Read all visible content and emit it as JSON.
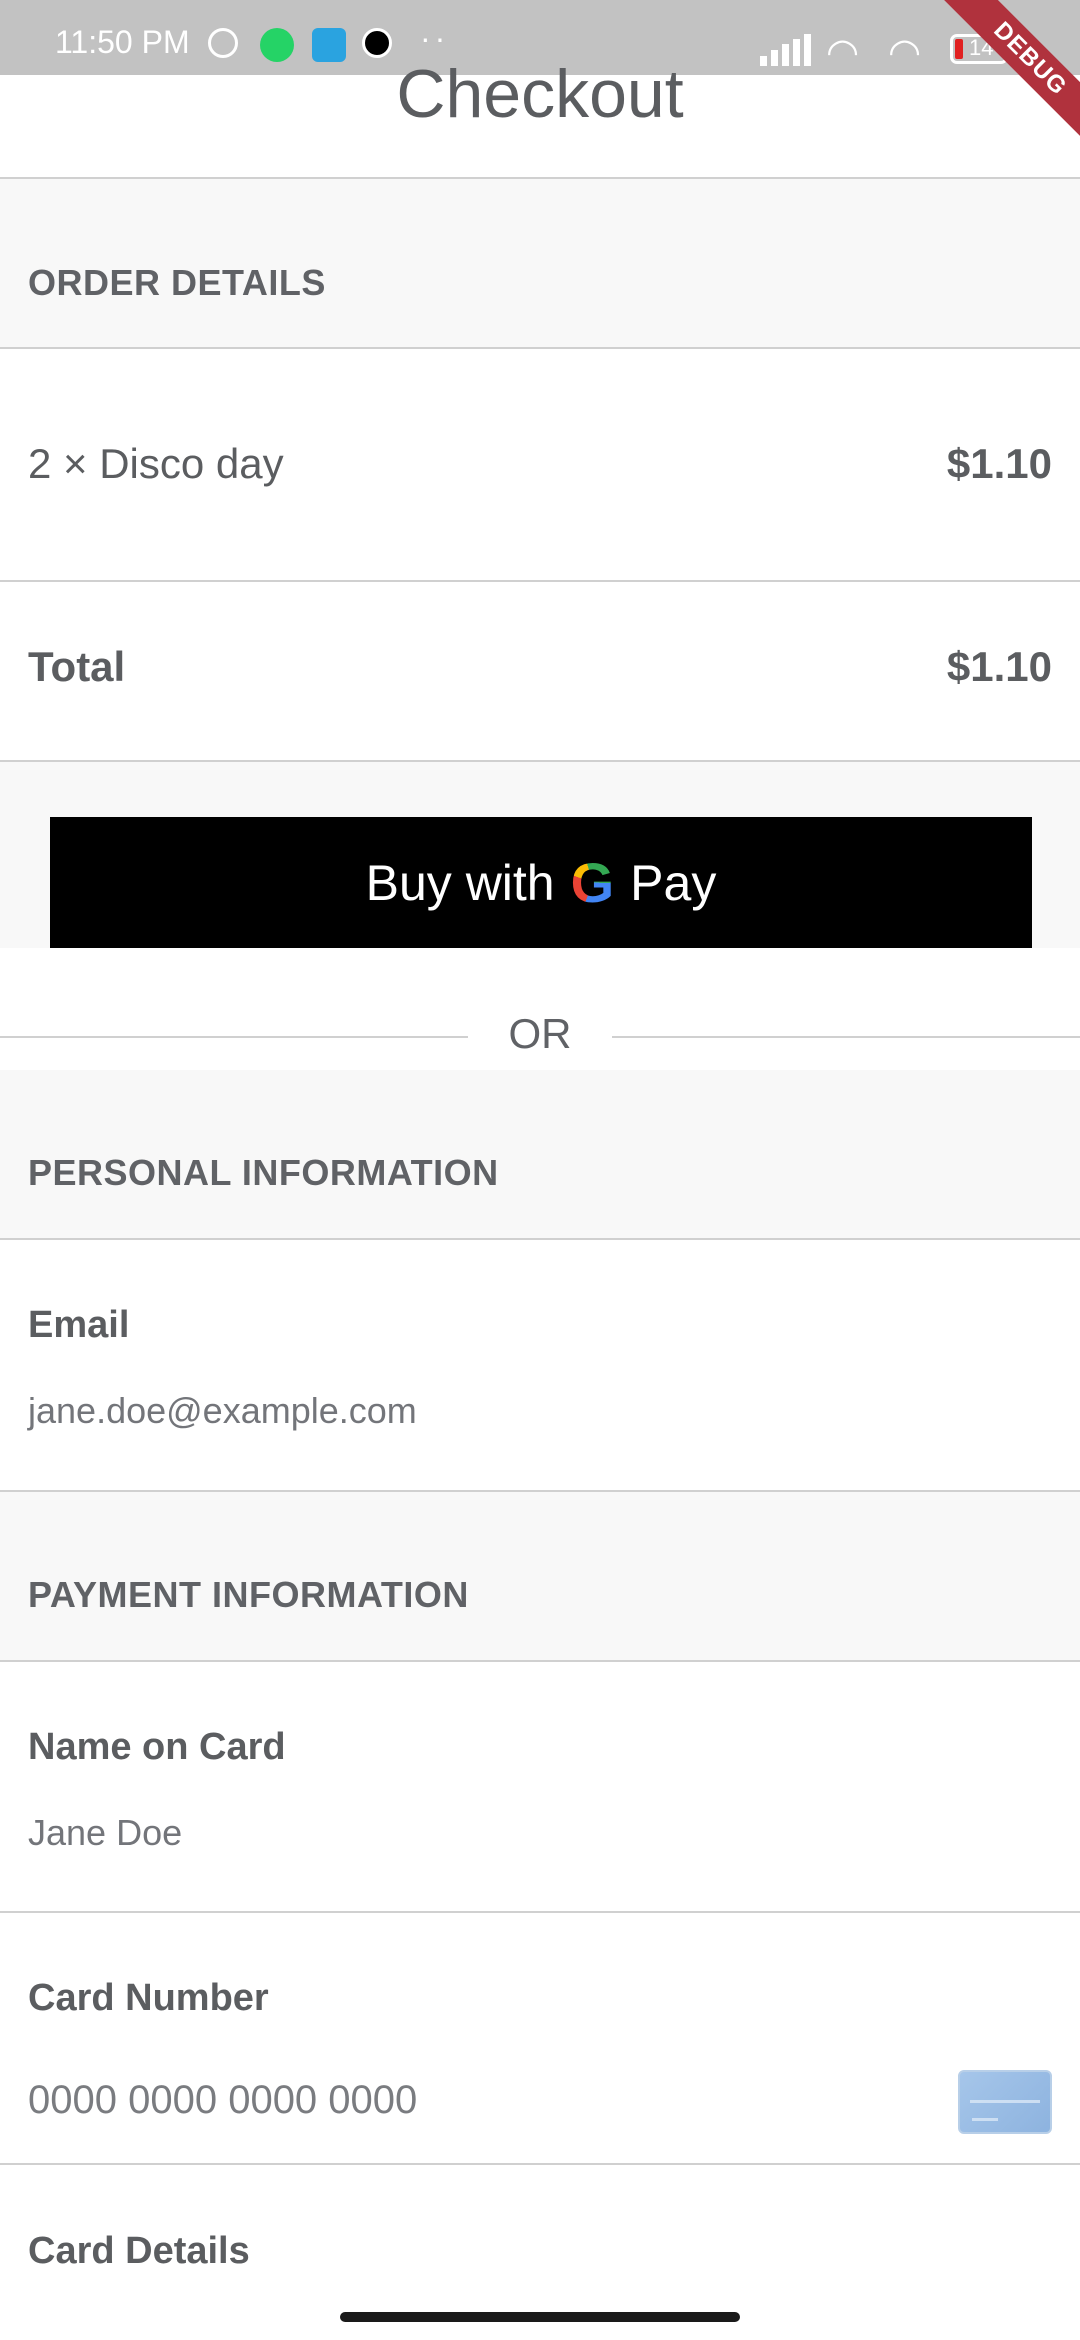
{
  "status_bar": {
    "time": "11:50 PM",
    "icons": [
      "alarm-icon",
      "whatsapp-icon",
      "telegram-icon",
      "clock-app-icon"
    ],
    "more": "··",
    "battery": "14",
    "debug_banner": "DEBUG"
  },
  "header": {
    "title": "Checkout"
  },
  "order": {
    "section_label": "ORDER DETAILS",
    "item_label": "2 × Disco day",
    "item_price": "$1.10",
    "total_label": "Total",
    "total_price": "$1.10"
  },
  "gpay": {
    "label_prefix": "Buy with",
    "label_g": "G",
    "label_suffix": "Pay"
  },
  "divider": {
    "or_text": "OR"
  },
  "personal": {
    "section_label": "PERSONAL INFORMATION",
    "email_label": "Email",
    "email_value": "jane.doe@example.com"
  },
  "payment": {
    "section_label": "PAYMENT INFORMATION",
    "name_label": "Name on Card",
    "name_value": "Jane Doe",
    "card_label": "Card Number",
    "card_placeholder": "0000 0000 0000 0000",
    "details_label": "Card Details"
  },
  "colors": {
    "accent_black": "#000000",
    "text_grey": "#5b5d60",
    "section_bg": "#f8f8f8",
    "debug": "#b0323d"
  }
}
